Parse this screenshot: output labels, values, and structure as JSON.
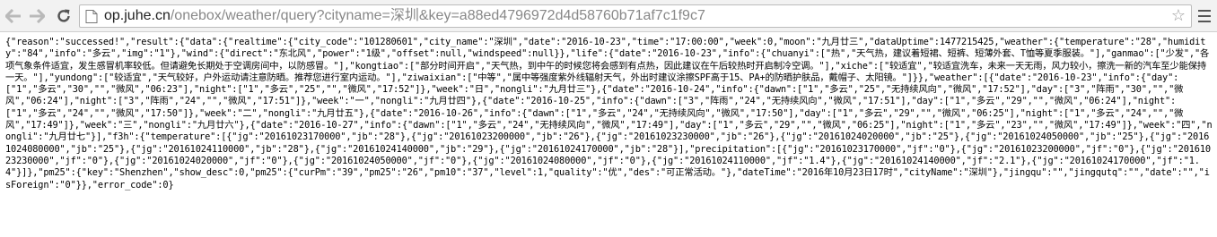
{
  "browser": {
    "url_host": "op.juhe.cn",
    "url_path": "/onebox/weather/query?cityname=深圳&key=a88ed4796972d4d58760b71af7c1f9c7",
    "icons": {
      "back": "arrow-left-icon",
      "forward": "arrow-right-icon",
      "reload": "reload-icon",
      "page": "page-icon",
      "bookmark": "star-icon",
      "menu": "hamburger-menu-icon"
    }
  },
  "page": {
    "json_text": "{\"reason\":\"successed!\",\"result\":{\"data\":{\"realtime\":{\"city_code\":\"101280601\",\"city_name\":\"深圳\",\"date\":\"2016-10-23\",\"time\":\"17:00:00\",\"week\":0,\"moon\":\"九月廿三\",\"dataUptime\":1477215425,\"weather\":{\"temperature\":\"28\",\"humidity\":\"84\",\"info\":\"多云\",\"img\":\"1\"},\"wind\":{\"direct\":\"东北风\",\"power\":\"1级\",\"offset\":null,\"windspeed\":null}},\"life\":{\"date\":\"2016-10-23\",\"info\":{\"chuanyi\":[\"热\",\"天气热，建议着短裙、短裤、短薄外套、T恤等夏季服装。\"],\"ganmao\":[\"少发\",\"各项气象条件适宜，发生感冒机率较低。但请避免长期处于空调房间中，以防感冒。\"],\"kongtiao\":[\"部分时间开启\",\"天气热，到中午的时候您将会感到有点热，因此建议在午后较热时开启制冷空调。\"],\"xiche\":[\"较适宜\",\"较适宜洗车，未来一天无雨，风力较小，擦洗一新的汽车至少能保持一天。\"],\"yundong\":[\"较适宜\",\"天气较好，户外运动请注意防晒。推荐您进行室内运动。\"],\"ziwaixian\":[\"中等\",\"属中等强度紫外线辐射天气，外出时建议涂擦SPF高于15、PA+的防晒护肤品，戴帽子、太阳镜。\"]}},\"weather\":[{\"date\":\"2016-10-23\",\"info\":{\"day\":[\"1\",\"多云\",\"30\",\"\",\"微风\",\"06:23\"],\"night\":[\"1\",\"多云\",\"25\",\"\",\"微风\",\"17:52\"]},\"week\":\"日\",\"nongli\":\"九月廿三\"},{\"date\":\"2016-10-24\",\"info\":{\"dawn\":[\"1\",\"多云\",\"25\",\"无持续风向\",\"微风\",\"17:52\"],\"day\":[\"3\",\"阵雨\",\"30\",\"\",\"微风\",\"06:24\"],\"night\":[\"3\",\"阵雨\",\"24\",\"\",\"微风\",\"17:51\"]},\"week\":\"一\",\"nongli\":\"九月廿四\"},{\"date\":\"2016-10-25\",\"info\":{\"dawn\":[\"3\",\"阵雨\",\"24\",\"无持续风向\",\"微风\",\"17:51\"],\"day\":[\"1\",\"多云\",\"29\",\"\",\"微风\",\"06:24\"],\"night\":[\"1\",\"多云\",\"24\",\"\",\"微风\",\"17:50\"]},\"week\":\"二\",\"nongli\":\"九月廿五\"},{\"date\":\"2016-10-26\",\"info\":{\"dawn\":[\"1\",\"多云\",\"24\",\"无持续风向\",\"微风\",\"17:50\"],\"day\":[\"1\",\"多云\",\"29\",\"\",\"微风\",\"06:25\"],\"night\":[\"1\",\"多云\",\"24\",\"\",\"微风\",\"17:49\"]},\"week\":\"三\",\"nongli\":\"九月廿六\"},{\"date\":\"2016-10-27\",\"info\":{\"dawn\":[\"1\",\"多云\",\"24\",\"无持续风向\",\"微风\",\"17:49\"],\"day\":[\"1\",\"多云\",\"29\",\"\",\"微风\",\"06:25\"],\"night\":[\"1\",\"多云\",\"23\",\"\",\"微风\",\"17:49\"]},\"week\":\"四\",\"nongli\":\"九月廿七\"}],\"f3h\":{\"temperature\":[{\"jg\":\"20161023170000\",\"jb\":\"28\"},{\"jg\":\"20161023200000\",\"jb\":\"26\"},{\"jg\":\"20161023230000\",\"jb\":\"26\"},{\"jg\":\"20161024020000\",\"jb\":\"25\"},{\"jg\":\"20161024050000\",\"jb\":\"25\"},{\"jg\":\"20161024080000\",\"jb\":\"25\"},{\"jg\":\"20161024110000\",\"jb\":\"28\"},{\"jg\":\"20161024140000\",\"jb\":\"29\"},{\"jg\":\"20161024170000\",\"jb\":\"28\"}],\"precipitation\":[{\"jg\":\"20161023170000\",\"jf\":\"0\"},{\"jg\":\"20161023200000\",\"jf\":\"0\"},{\"jg\":\"20161023230000\",\"jf\":\"0\"},{\"jg\":\"20161024020000\",\"jf\":\"0\"},{\"jg\":\"20161024050000\",\"jf\":\"0\"},{\"jg\":\"20161024080000\",\"jf\":\"0\"},{\"jg\":\"20161024110000\",\"jf\":\"1.4\"},{\"jg\":\"20161024140000\",\"jf\":\"2.1\"},{\"jg\":\"20161024170000\",\"jf\":\"1.4\"}]},\"pm25\":{\"key\":\"Shenzhen\",\"show_desc\":0,\"pm25\":{\"curPm\":\"39\",\"pm25\":\"26\",\"pm10\":\"37\",\"level\":1,\"quality\":\"优\",\"des\":\"可正常活动。\"},\"dateTime\":\"2016年10月23日17时\",\"cityName\":\"深圳\"},\"jingqu\":\"\",\"jingqutq\":\"\",\"date\":\"\",\"isForeign\":\"0\"}},\"error_code\":0}"
  }
}
